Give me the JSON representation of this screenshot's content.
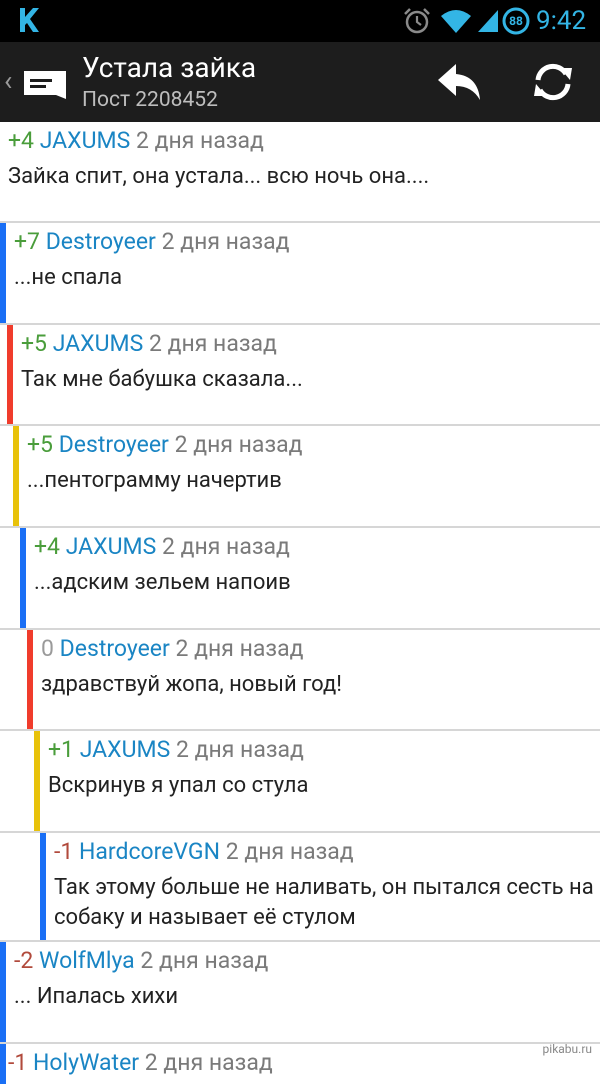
{
  "status_bar": {
    "battery_level": "88",
    "time": "9:42",
    "icons": [
      "k-app-icon",
      "alarm-icon",
      "wifi-icon",
      "signal-icon",
      "battery-icon"
    ]
  },
  "action_bar": {
    "title": "Устала зайка",
    "subtitle": "Пост 2208452",
    "icons": [
      "back-chevron-icon",
      "logo-icon",
      "reply-icon",
      "refresh-icon"
    ]
  },
  "colors": {
    "blue": "#1a6ff5",
    "red": "#f03c2c",
    "yellow": "#e8c20a",
    "positive": "#4a9d3b",
    "negative": "#b14a3c",
    "author": "#1a85c4"
  },
  "comments": [
    {
      "score": "+4",
      "author": "JAXUMS",
      "time": "2 дня назад",
      "text": "Зайка спит, она устала... всю ночь она....",
      "depth": 0,
      "bar_color": ""
    },
    {
      "score": "+7",
      "author": "Destroyeer",
      "time": "2 дня назад",
      "text": "...не спала",
      "depth": 1,
      "bar_color": "blue"
    },
    {
      "score": "+5",
      "author": "JAXUMS",
      "time": "2 дня назад",
      "text": "Так мне бабушка сказала...",
      "depth": 2,
      "bar_color": "red"
    },
    {
      "score": "+5",
      "author": "Destroyeer",
      "time": "2 дня назад",
      "text": "...пентограмму начертив",
      "depth": 3,
      "bar_color": "yellow"
    },
    {
      "score": "+4",
      "author": "JAXUMS",
      "time": "2 дня назад",
      "text": "...адским зельем напоив",
      "depth": 4,
      "bar_color": "blue"
    },
    {
      "score": "0",
      "author": "Destroyeer",
      "time": "2 дня назад",
      "text": "здравствуй жопа, новый год!",
      "depth": 5,
      "bar_color": "red"
    },
    {
      "score": "+1",
      "author": "JAXUMS",
      "time": "2 дня назад",
      "text": "Вскринув я упал со стула",
      "depth": 6,
      "bar_color": "yellow"
    },
    {
      "score": "-1",
      "author": "HardcoreVGN",
      "time": "2 дня назад",
      "text": "Так этому больше не наливать, он пытался сесть на собаку и называет её стулом",
      "depth": 7,
      "bar_color": "blue"
    },
    {
      "score": "-2",
      "author": "WolfMlya",
      "time": "2 дня назад",
      "text": "... Ипалась хихи",
      "depth": 1,
      "bar_color": "blue"
    },
    {
      "score": "-1",
      "author": "HolyWater",
      "time": "2 дня назад",
      "text": "",
      "depth": 1,
      "bar_color": "blue"
    }
  ],
  "watermark": "pikabu.ru"
}
